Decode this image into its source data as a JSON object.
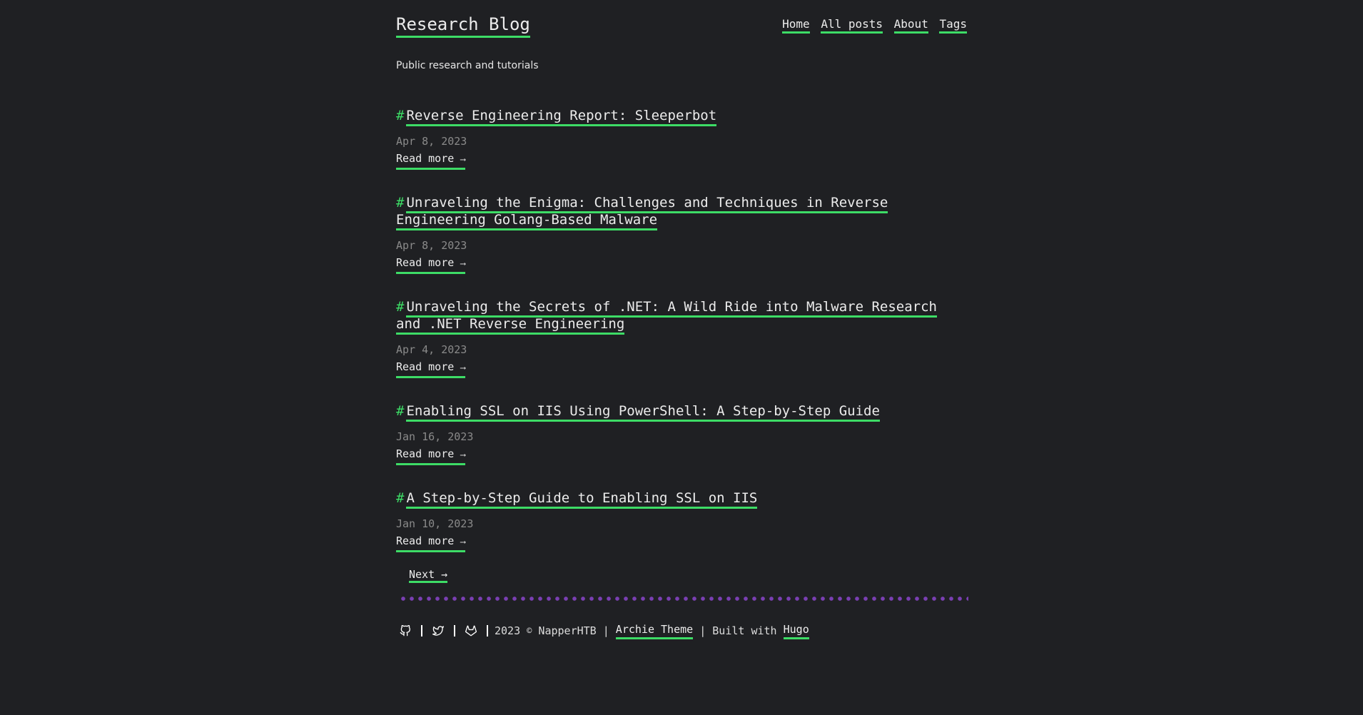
{
  "site": {
    "title": "Research Blog",
    "tagline": "Public research and tutorials"
  },
  "nav": [
    {
      "label": "Home"
    },
    {
      "label": "All posts"
    },
    {
      "label": "About"
    },
    {
      "label": "Tags"
    }
  ],
  "posts": [
    {
      "title": "Reverse Engineering Report: Sleeperbot",
      "date": "Apr 8, 2023",
      "read_more": "Read more",
      "arrow": "⟶"
    },
    {
      "title": "Unraveling the Enigma: Challenges and Techniques in Reverse Engineering Golang-Based Malware",
      "date": "Apr 8, 2023",
      "read_more": "Read more",
      "arrow": "⟶"
    },
    {
      "title": "Unraveling the Secrets of .NET: A Wild Ride into Malware Research and .NET Reverse Engineering",
      "date": "Apr 4, 2023",
      "read_more": "Read more",
      "arrow": "⟶"
    },
    {
      "title": "Enabling SSL on IIS Using PowerShell: A Step-by-Step Guide",
      "date": "Jan 16, 2023",
      "read_more": "Read more",
      "arrow": "⟶"
    },
    {
      "title": "A Step-by-Step Guide to Enabling SSL on IIS",
      "date": "Jan 10, 2023",
      "read_more": "Read more",
      "arrow": "⟶"
    }
  ],
  "pager": {
    "next_label": "Next →"
  },
  "footer": {
    "icons": [
      "github-icon",
      "twitter-icon",
      "gitlab-icon"
    ],
    "year": "2023",
    "copyright_symbol": "©",
    "author": "NapperHTB",
    "separator": "|",
    "theme_link": "Archie Theme",
    "built_with": "Built with",
    "hugo_link": "Hugo"
  },
  "colors": {
    "background": "#1f2023",
    "accent": "#3ddc66",
    "divider": "#7a3fb3",
    "date": "#8a8a8a"
  }
}
